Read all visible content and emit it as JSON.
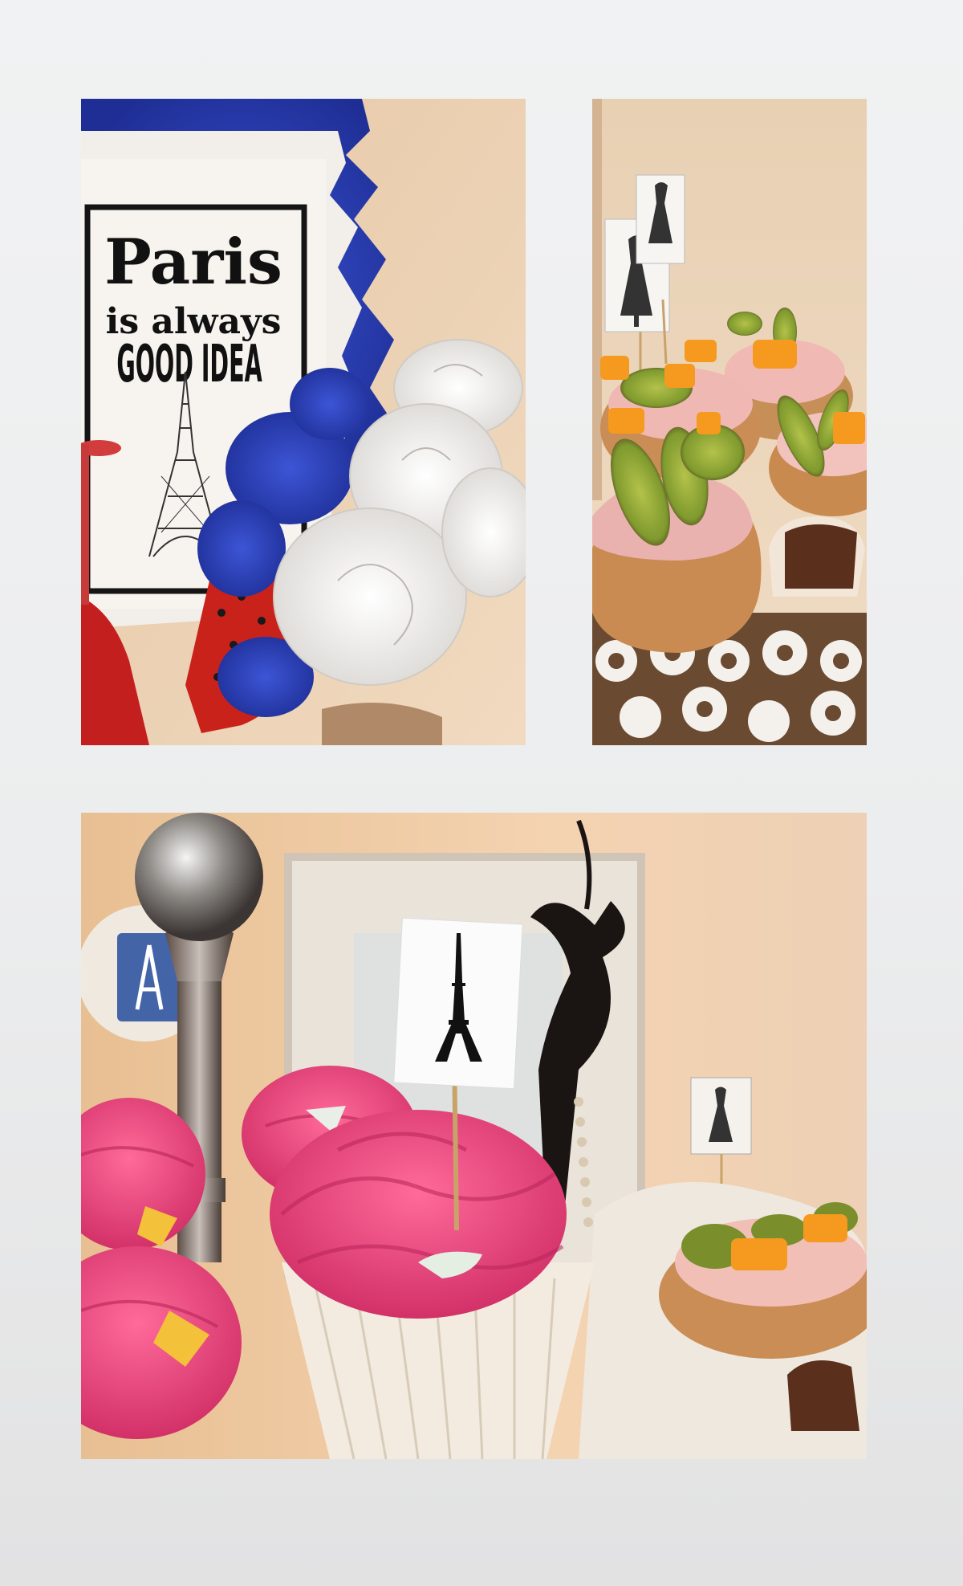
{
  "collage": {
    "photos": [
      {
        "subject": "paris-sign-with-paper-flowers"
      },
      {
        "subject": "fruit-tartlets-on-doily"
      },
      {
        "subject": "pink-cupcakes-with-eiffel-topper"
      }
    ]
  },
  "sign": {
    "line1": "Paris",
    "line2": "is always",
    "line3": "GOOD IDEA"
  },
  "colors": {
    "background": "#eeeff0",
    "wall": "#ecd2b4",
    "tricolor_blue": "#2a3fb8",
    "tricolor_white": "#f4f1ec",
    "tricolor_red": "#c8221b",
    "frosting_pink": "#e3477d",
    "kiwi": "#7a8f2c",
    "peach": "#f59a1e"
  }
}
